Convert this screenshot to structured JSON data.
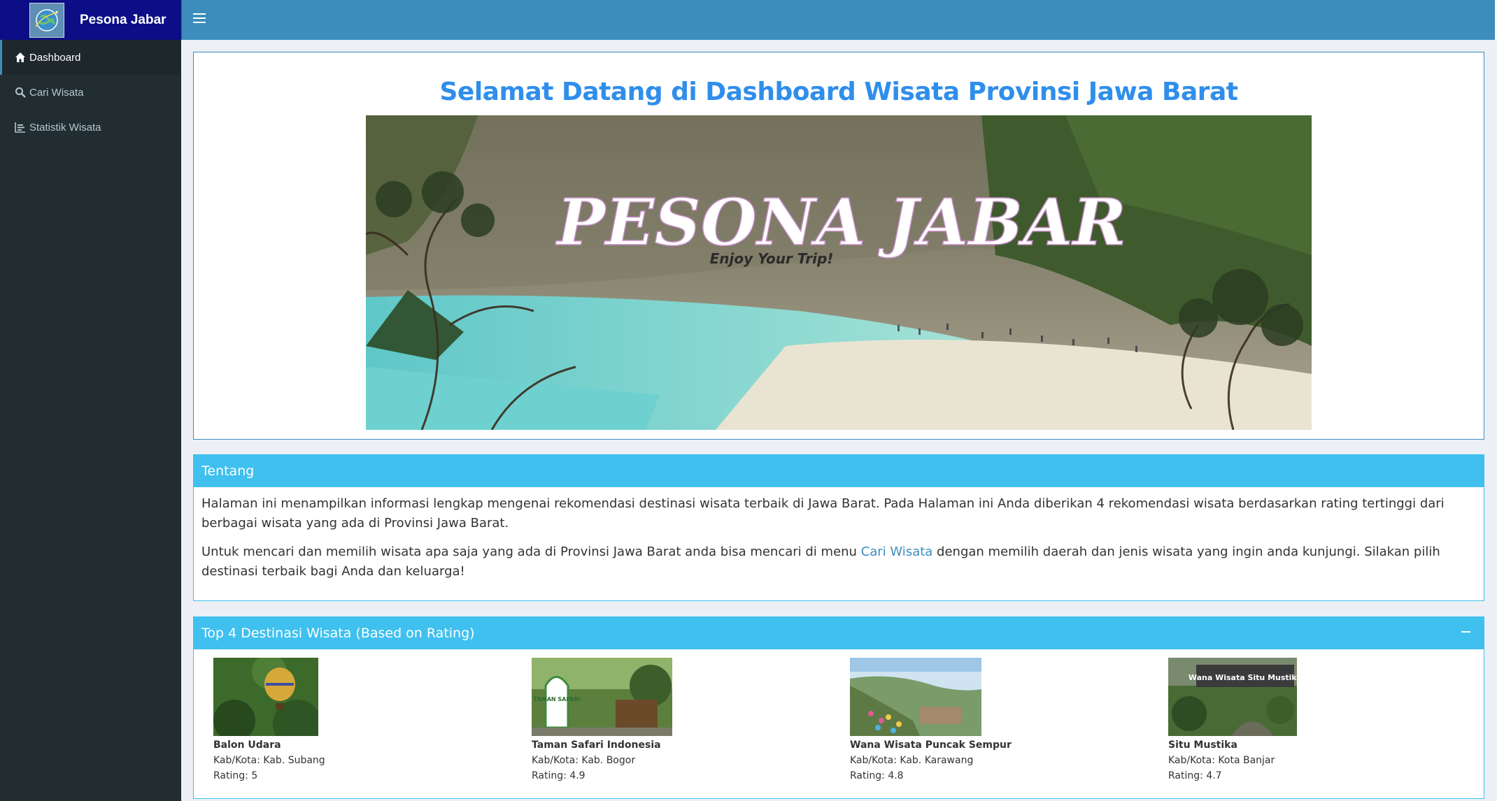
{
  "brand": {
    "name": "Pesona Jabar",
    "logo_icon": "globe-travel-icon"
  },
  "topnav": {
    "toggle_icon": "hamburger-icon"
  },
  "sidebar": {
    "items": [
      {
        "label": "Dashboard",
        "icon": "home-icon",
        "active": true
      },
      {
        "label": "Cari Wisata",
        "icon": "search-icon",
        "active": false
      },
      {
        "label": "Statistik Wisata",
        "icon": "bar-chart-icon",
        "active": false
      }
    ]
  },
  "hero": {
    "title": "Selamat Datang di Dashboard Wisata Provinsi Jawa Barat",
    "banner_text": "PESONA JABAR",
    "banner_tagline": "Enjoy Your Trip!"
  },
  "about": {
    "title": "Tentang",
    "paragraph1": "Halaman ini menampilkan informasi lengkap mengenai rekomendasi destinasi wisata terbaik di Jawa Barat. Pada Halaman ini Anda diberikan 4 rekomendasi wisata berdasarkan rating tertinggi dari berbagai wisata yang ada di Provinsi Jawa Barat.",
    "paragraph2_before": "Untuk mencari dan memilih wisata apa saja yang ada di Provinsi Jawa Barat anda bisa mencari di menu ",
    "paragraph2_link": "Cari Wisata",
    "paragraph2_after": " dengan memilih daerah dan jenis wisata yang ingin anda kunjungi. Silakan pilih destinasi terbaik bagi Anda dan keluarga!"
  },
  "top": {
    "title": "Top 4 Destinasi Wisata (Based on Rating)",
    "collapse_icon": "minus-icon",
    "kab_label": "Kab/Kota:",
    "rating_label": "Rating:",
    "items": [
      {
        "name": "Balon Udara",
        "kab": "Kab. Subang",
        "rating": "5"
      },
      {
        "name": "Taman Safari Indonesia",
        "kab": "Kab. Bogor",
        "rating": "4.9"
      },
      {
        "name": "Wana Wisata Puncak Sempur",
        "kab": "Kab. Karawang",
        "rating": "4.8"
      },
      {
        "name": "Situ Mustika",
        "kab": "Kota Banjar",
        "rating": "4.7"
      }
    ],
    "thumb_texts": {
      "safari": "TAMAN SAFARI",
      "situ": "Wana Wisata Situ Mustika"
    }
  },
  "colors": {
    "brand_bg": "#0b0e86",
    "topbar": "#3c8dbc",
    "sidebar": "#222d32",
    "box_header": "#3fc0ef",
    "title": "#2f8eeb"
  }
}
